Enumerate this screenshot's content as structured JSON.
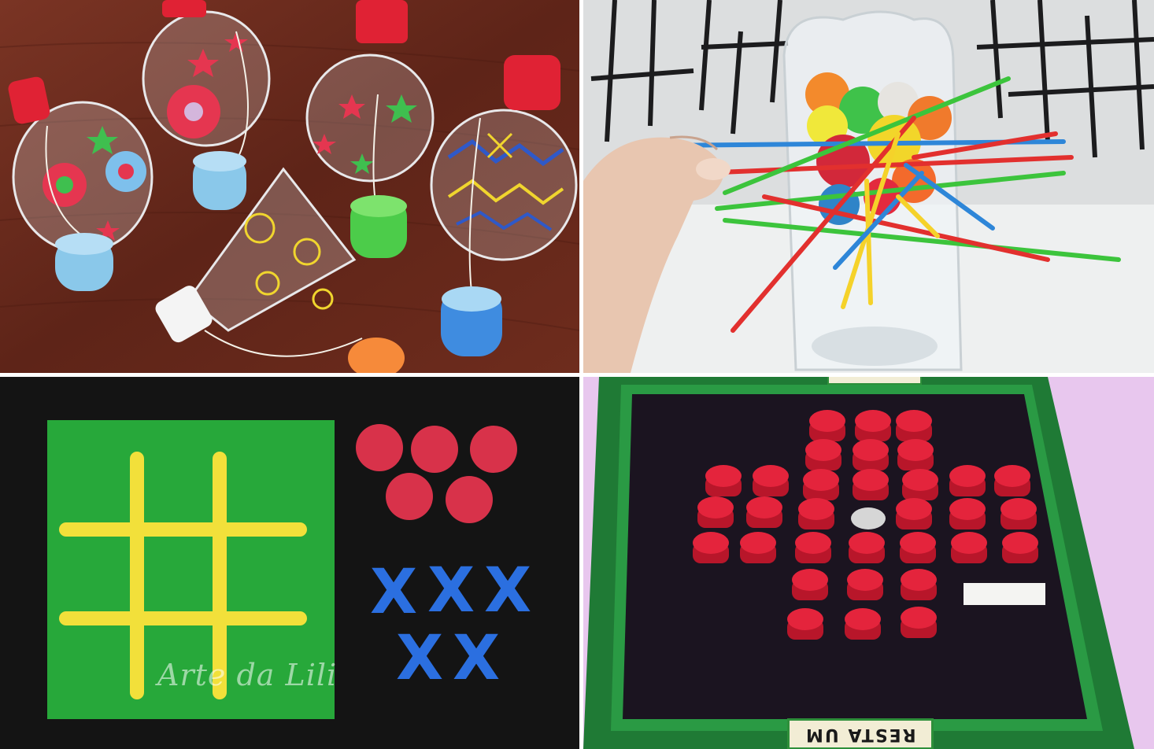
{
  "panels": {
    "bottom_left": {
      "watermark": "Arte da Lili"
    },
    "bottom_right": {
      "board_label": "RESTA UM"
    }
  },
  "colors": {
    "wood": "#6b2a1e",
    "foam_green": "#27a83a",
    "popsicle_yellow": "#f2e03a",
    "chip_red": "#d8324a",
    "foam_blue": "#2b6fe0",
    "cap_red": "#e4243c",
    "board_black": "#1b1420",
    "board_frame_green": "#1f7a35",
    "lilac_background": "#e8c7ee"
  }
}
